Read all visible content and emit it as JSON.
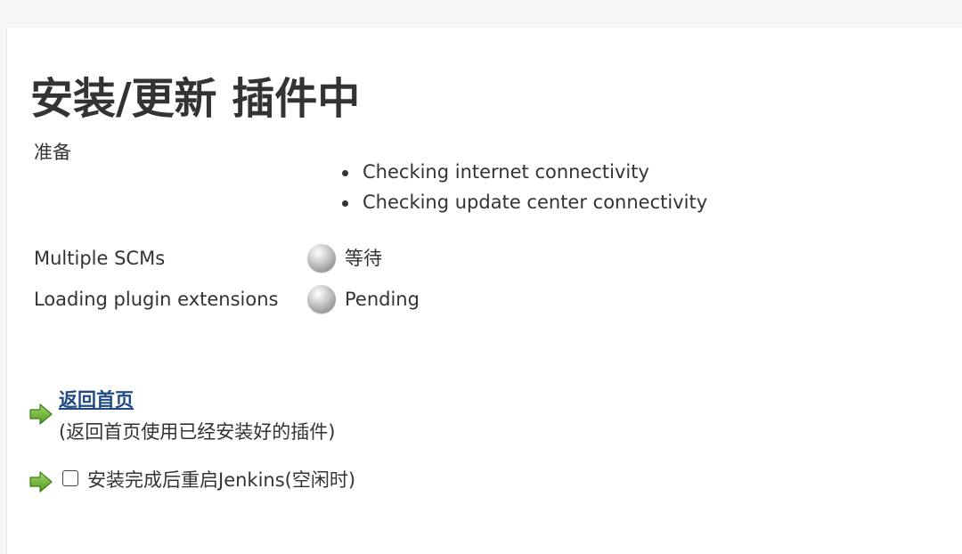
{
  "page": {
    "title": "安装/更新 插件中"
  },
  "preparation": {
    "label": "准备",
    "items": [
      "Checking internet connectivity",
      "Checking update center connectivity"
    ]
  },
  "jobs": [
    {
      "name": "Multiple SCMs",
      "status": "等待",
      "status_icon": "gray-ball-icon"
    },
    {
      "name": "Loading plugin extensions",
      "status": "Pending",
      "status_icon": "gray-ball-icon"
    }
  ],
  "actions": {
    "home_link": "返回首页",
    "home_desc": "(返回首页使用已经安装好的插件)",
    "restart_label": "安装完成后重启Jenkins(空闲时)",
    "restart_checked": false,
    "arrow_icon": "green-arrow-icon"
  },
  "colors": {
    "link": "#204a87",
    "text": "#333333",
    "arrow": "#6aa84f"
  }
}
